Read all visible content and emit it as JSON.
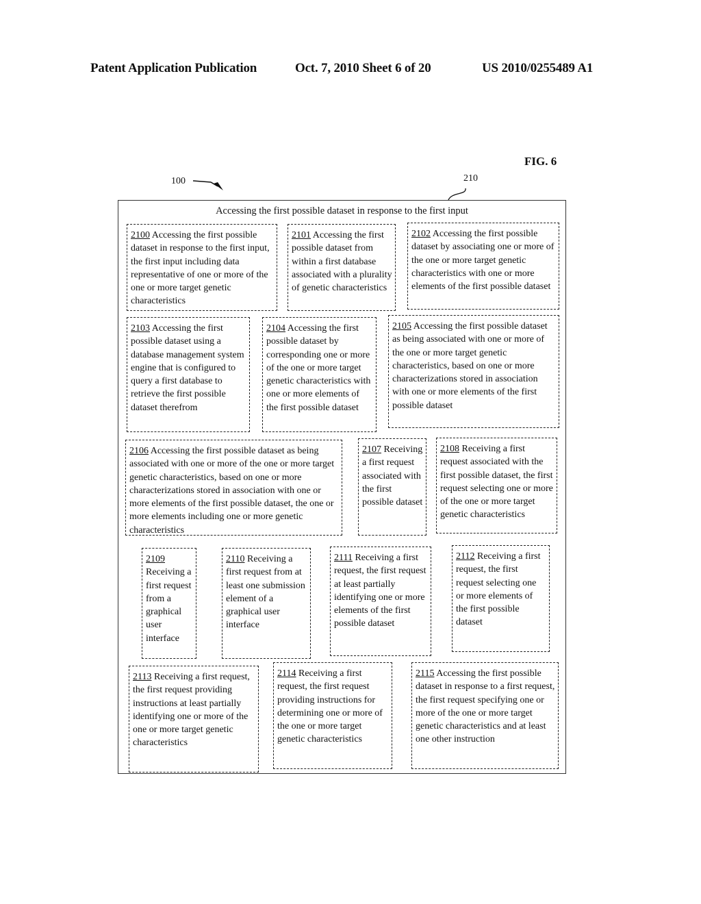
{
  "header": {
    "left": "Patent Application Publication",
    "date_sheet": "Oct. 7, 2010   Sheet 6 of 20",
    "publication_number": "US 2010/0255489 A1"
  },
  "figure": {
    "label": "FIG. 6",
    "ref_system": "100",
    "ref_block": "210",
    "outer_title": "Accessing the first possible dataset in response to the first input"
  },
  "boxes": [
    {
      "num": "2100",
      "text": " Accessing the first possible dataset in response to the first input, the first input including data representative of one or more of the one or more target genetic characteristics"
    },
    {
      "num": "2101",
      "text": " Accessing the first possible dataset from within a first database associated with a plurality of genetic characteristics"
    },
    {
      "num": "2102",
      "text": " Accessing the first possible dataset by associating one or more of the one or more target genetic characteristics with one or more elements of the first possible dataset"
    },
    {
      "num": "2103",
      "text": " Accessing the first possible dataset using a database management system engine that is configured to query a first database to retrieve the first possible dataset therefrom"
    },
    {
      "num": "2104",
      "text": " Accessing the first possible dataset by corresponding one or more of the one or more target genetic characteristics with one or more elements of the first possible dataset"
    },
    {
      "num": "2105",
      "text": " Accessing the first possible dataset as being associated with one or more of the one or more target genetic characteristics, based on one or more characterizations stored in association with one or more elements of the first possible dataset"
    },
    {
      "num": "2106",
      "text": " Accessing the first possible dataset as being associated with one or more of the one or more target genetic characteristics, based on one or more characterizations stored in association with one or more elements of the first possible dataset, the one or more elements including one or more genetic characteristics"
    },
    {
      "num": "2107",
      "text": " Receiving a first request associated with the first possible dataset"
    },
    {
      "num": "2108",
      "text": " Receiving a first request associated with the first possible dataset, the first request selecting one or more of the one or more target genetic characteristics"
    },
    {
      "num": "2109",
      "text": " Receiving a first request from a graphical user interface"
    },
    {
      "num": "2110",
      "text": " Receiving a first request from at least one submission element of a graphical user interface"
    },
    {
      "num": "2111",
      "text": " Receiving a first request, the first request at least partially identifying one or more elements of the first possible dataset"
    },
    {
      "num": "2112",
      "text": " Receiving a first request, the first request selecting one or more elements of the first possible dataset"
    },
    {
      "num": "2113",
      "text": " Receiving a first request, the first request providing instructions at least partially identifying one or more of the one or more target genetic characteristics"
    },
    {
      "num": "2114",
      "text": " Receiving a first request, the first request providing instructions for determining one or more of the one or more target genetic characteristics"
    },
    {
      "num": "2115",
      "text": " Accessing the first possible dataset in response to a first request, the first request specifying one or more of the one or more target genetic characteristics and at least one other instruction"
    }
  ]
}
